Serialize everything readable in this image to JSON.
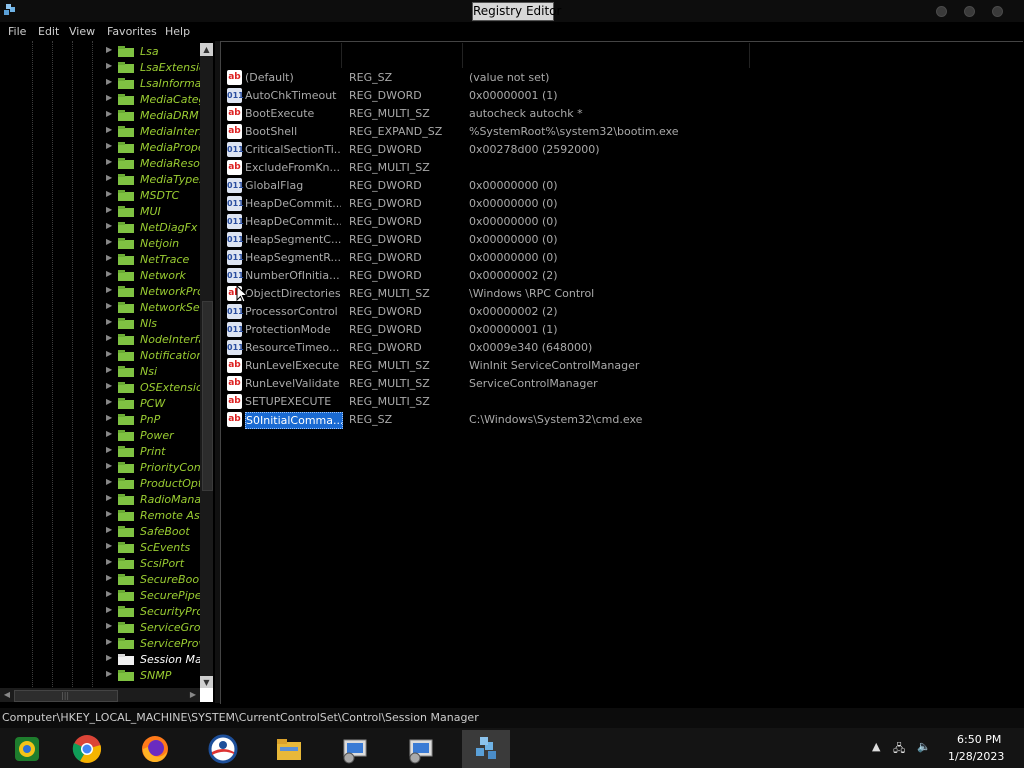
{
  "window": {
    "title": "Registry Editor"
  },
  "menu": [
    "File",
    "Edit",
    "View",
    "Favorites",
    "Help"
  ],
  "tree": {
    "items": [
      {
        "label": "Lsa"
      },
      {
        "label": "LsaExtensio"
      },
      {
        "label": "LsaInformat"
      },
      {
        "label": "MediaCateg"
      },
      {
        "label": "MediaDRM"
      },
      {
        "label": "MediaInterfa"
      },
      {
        "label": "MediaPrope"
      },
      {
        "label": "MediaResou"
      },
      {
        "label": "MediaTypes"
      },
      {
        "label": "MSDTC"
      },
      {
        "label": "MUI"
      },
      {
        "label": "NetDiagFx"
      },
      {
        "label": "Netjoin"
      },
      {
        "label": "NetTrace"
      },
      {
        "label": "Network"
      },
      {
        "label": "NetworkPro"
      },
      {
        "label": "NetworkSet"
      },
      {
        "label": "Nls"
      },
      {
        "label": "NodeInterfa"
      },
      {
        "label": "Notification"
      },
      {
        "label": "Nsi"
      },
      {
        "label": "OSExtension"
      },
      {
        "label": "PCW"
      },
      {
        "label": "PnP"
      },
      {
        "label": "Power"
      },
      {
        "label": "Print"
      },
      {
        "label": "PriorityCont"
      },
      {
        "label": "ProductOpti"
      },
      {
        "label": "RadioManag"
      },
      {
        "label": "Remote Ass"
      },
      {
        "label": "SafeBoot"
      },
      {
        "label": "ScEvents"
      },
      {
        "label": "ScsiPort"
      },
      {
        "label": "SecureBoot"
      },
      {
        "label": "SecurePipeS"
      },
      {
        "label": "SecurityProv"
      },
      {
        "label": "ServiceGrou"
      },
      {
        "label": "ServiceProv"
      },
      {
        "label": "Session Mar",
        "selected": true
      },
      {
        "label": "SNMP"
      }
    ]
  },
  "values": [
    {
      "icon": "string-value-icon",
      "name": "(Default)",
      "type": "REG_SZ",
      "data": "(value not set)"
    },
    {
      "icon": "dword-value-icon",
      "name": "AutoChkTimeout",
      "type": "REG_DWORD",
      "data": "0x00000001 (1)"
    },
    {
      "icon": "string-value-icon",
      "name": "BootExecute",
      "type": "REG_MULTI_SZ",
      "data": "autocheck autochk *"
    },
    {
      "icon": "string-value-icon",
      "name": "BootShell",
      "type": "REG_EXPAND_SZ",
      "data": "%SystemRoot%\\system32\\bootim.exe"
    },
    {
      "icon": "dword-value-icon",
      "name": "CriticalSectionTi...",
      "type": "REG_DWORD",
      "data": "0x00278d00 (2592000)"
    },
    {
      "icon": "string-value-icon",
      "name": "ExcludeFromKn...",
      "type": "REG_MULTI_SZ",
      "data": ""
    },
    {
      "icon": "dword-value-icon",
      "name": "GlobalFlag",
      "type": "REG_DWORD",
      "data": "0x00000000 (0)"
    },
    {
      "icon": "dword-value-icon",
      "name": "HeapDeCommit...",
      "type": "REG_DWORD",
      "data": "0x00000000 (0)"
    },
    {
      "icon": "dword-value-icon",
      "name": "HeapDeCommit...",
      "type": "REG_DWORD",
      "data": "0x00000000 (0)"
    },
    {
      "icon": "dword-value-icon",
      "name": "HeapSegmentC...",
      "type": "REG_DWORD",
      "data": "0x00000000 (0)"
    },
    {
      "icon": "dword-value-icon",
      "name": "HeapSegmentR...",
      "type": "REG_DWORD",
      "data": "0x00000000 (0)"
    },
    {
      "icon": "dword-value-icon",
      "name": "NumberOfInitia...",
      "type": "REG_DWORD",
      "data": "0x00000002 (2)"
    },
    {
      "icon": "string-value-icon",
      "name": "ObjectDirectories",
      "type": "REG_MULTI_SZ",
      "data": "\\Windows \\RPC Control"
    },
    {
      "icon": "dword-value-icon",
      "name": "ProcessorControl",
      "type": "REG_DWORD",
      "data": "0x00000002 (2)"
    },
    {
      "icon": "dword-value-icon",
      "name": "ProtectionMode",
      "type": "REG_DWORD",
      "data": "0x00000001 (1)"
    },
    {
      "icon": "dword-value-icon",
      "name": "ResourceTimeo...",
      "type": "REG_DWORD",
      "data": "0x0009e340 (648000)"
    },
    {
      "icon": "string-value-icon",
      "name": "RunLevelExecute",
      "type": "REG_MULTI_SZ",
      "data": "WinInit ServiceControlManager"
    },
    {
      "icon": "string-value-icon",
      "name": "RunLevelValidate",
      "type": "REG_MULTI_SZ",
      "data": "ServiceControlManager"
    },
    {
      "icon": "string-value-icon",
      "name": "SETUPEXECUTE",
      "type": "REG_MULTI_SZ",
      "data": ""
    },
    {
      "icon": "string-value-icon",
      "name": "S0InitialComma...",
      "type": "REG_SZ",
      "data": "C:\\Windows\\System32\\cmd.exe",
      "selected": true
    }
  ],
  "status": "Computer\\HKEY_LOCAL_MACHINE\\SYSTEM\\CurrentControlSet\\Control\\Session Manager",
  "taskbar": {
    "apps": [
      "app-launcher-icon",
      "chrome-icon",
      "firefox-icon",
      "obama-logo-icon",
      "file-explorer-icon",
      "regedit-task-icon",
      "regedit-task-icon",
      "registry-editor-icon"
    ],
    "time": "6:50 PM",
    "date": "1/28/2023"
  },
  "colors": {
    "tree_label": "#9acd32",
    "selection": "#1a6ad2"
  }
}
